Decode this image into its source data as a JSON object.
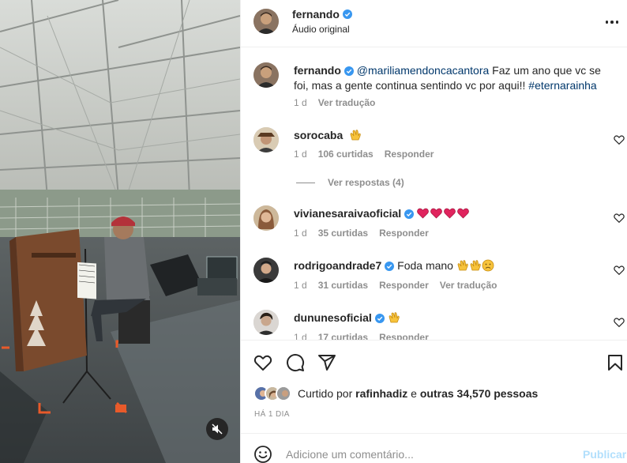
{
  "post": {
    "author": "fernando",
    "audio": "Áudio original",
    "verified": true
  },
  "comments": [
    {
      "author": "fernando",
      "verified": true,
      "mention": "@mariliamendoncacantora",
      "text": " Faz um ano que vc se foi, mas a gente continua sentindo vc por aqui!! ",
      "hashtag": "#eternarainha",
      "time": "1 d",
      "translate": "Ver tradução"
    },
    {
      "author": "sorocaba",
      "verified": false,
      "emojis": [
        "clap"
      ],
      "time": "1 d",
      "likes": "106 curtidas",
      "reply": "Responder",
      "view_replies": "Ver respostas (4)"
    },
    {
      "author": "vivianesaraivaoficial",
      "verified": true,
      "emojis": [
        "heart",
        "heart",
        "heart",
        "heart"
      ],
      "time": "1 d",
      "likes": "35 curtidas",
      "reply": "Responder"
    },
    {
      "author": "rodrigoandrade7",
      "verified": true,
      "text": "Foda mano ",
      "emojis": [
        "clap",
        "clap",
        "sad"
      ],
      "time": "1 d",
      "likes": "31 curtidas",
      "reply": "Responder",
      "translate": "Ver tradução"
    },
    {
      "author": "dununesoficial",
      "verified": true,
      "emojis": [
        "clap"
      ],
      "time": "1 d",
      "likes": "17 curtidas",
      "reply": "Responder"
    }
  ],
  "likes": {
    "prefix": "Curtido por ",
    "user": "rafinhadiz",
    "middle": " e ",
    "others": "outras 34,570 pessoas"
  },
  "timestamp": "HÁ 1 DIA",
  "composer": {
    "placeholder": "Adicione um comentário...",
    "publish": "Publicar"
  },
  "icons": {
    "more": "more-options-icon",
    "like": "heart-icon",
    "comment": "comment-icon",
    "share": "share-icon",
    "save": "bookmark-icon",
    "emoji": "emoji-icon",
    "mute": "muted-speaker-icon"
  },
  "colors": {
    "verified": "#3897f0",
    "link": "#00376b",
    "publish": "#b2dffc",
    "muted_text": "#8e8e8e"
  }
}
